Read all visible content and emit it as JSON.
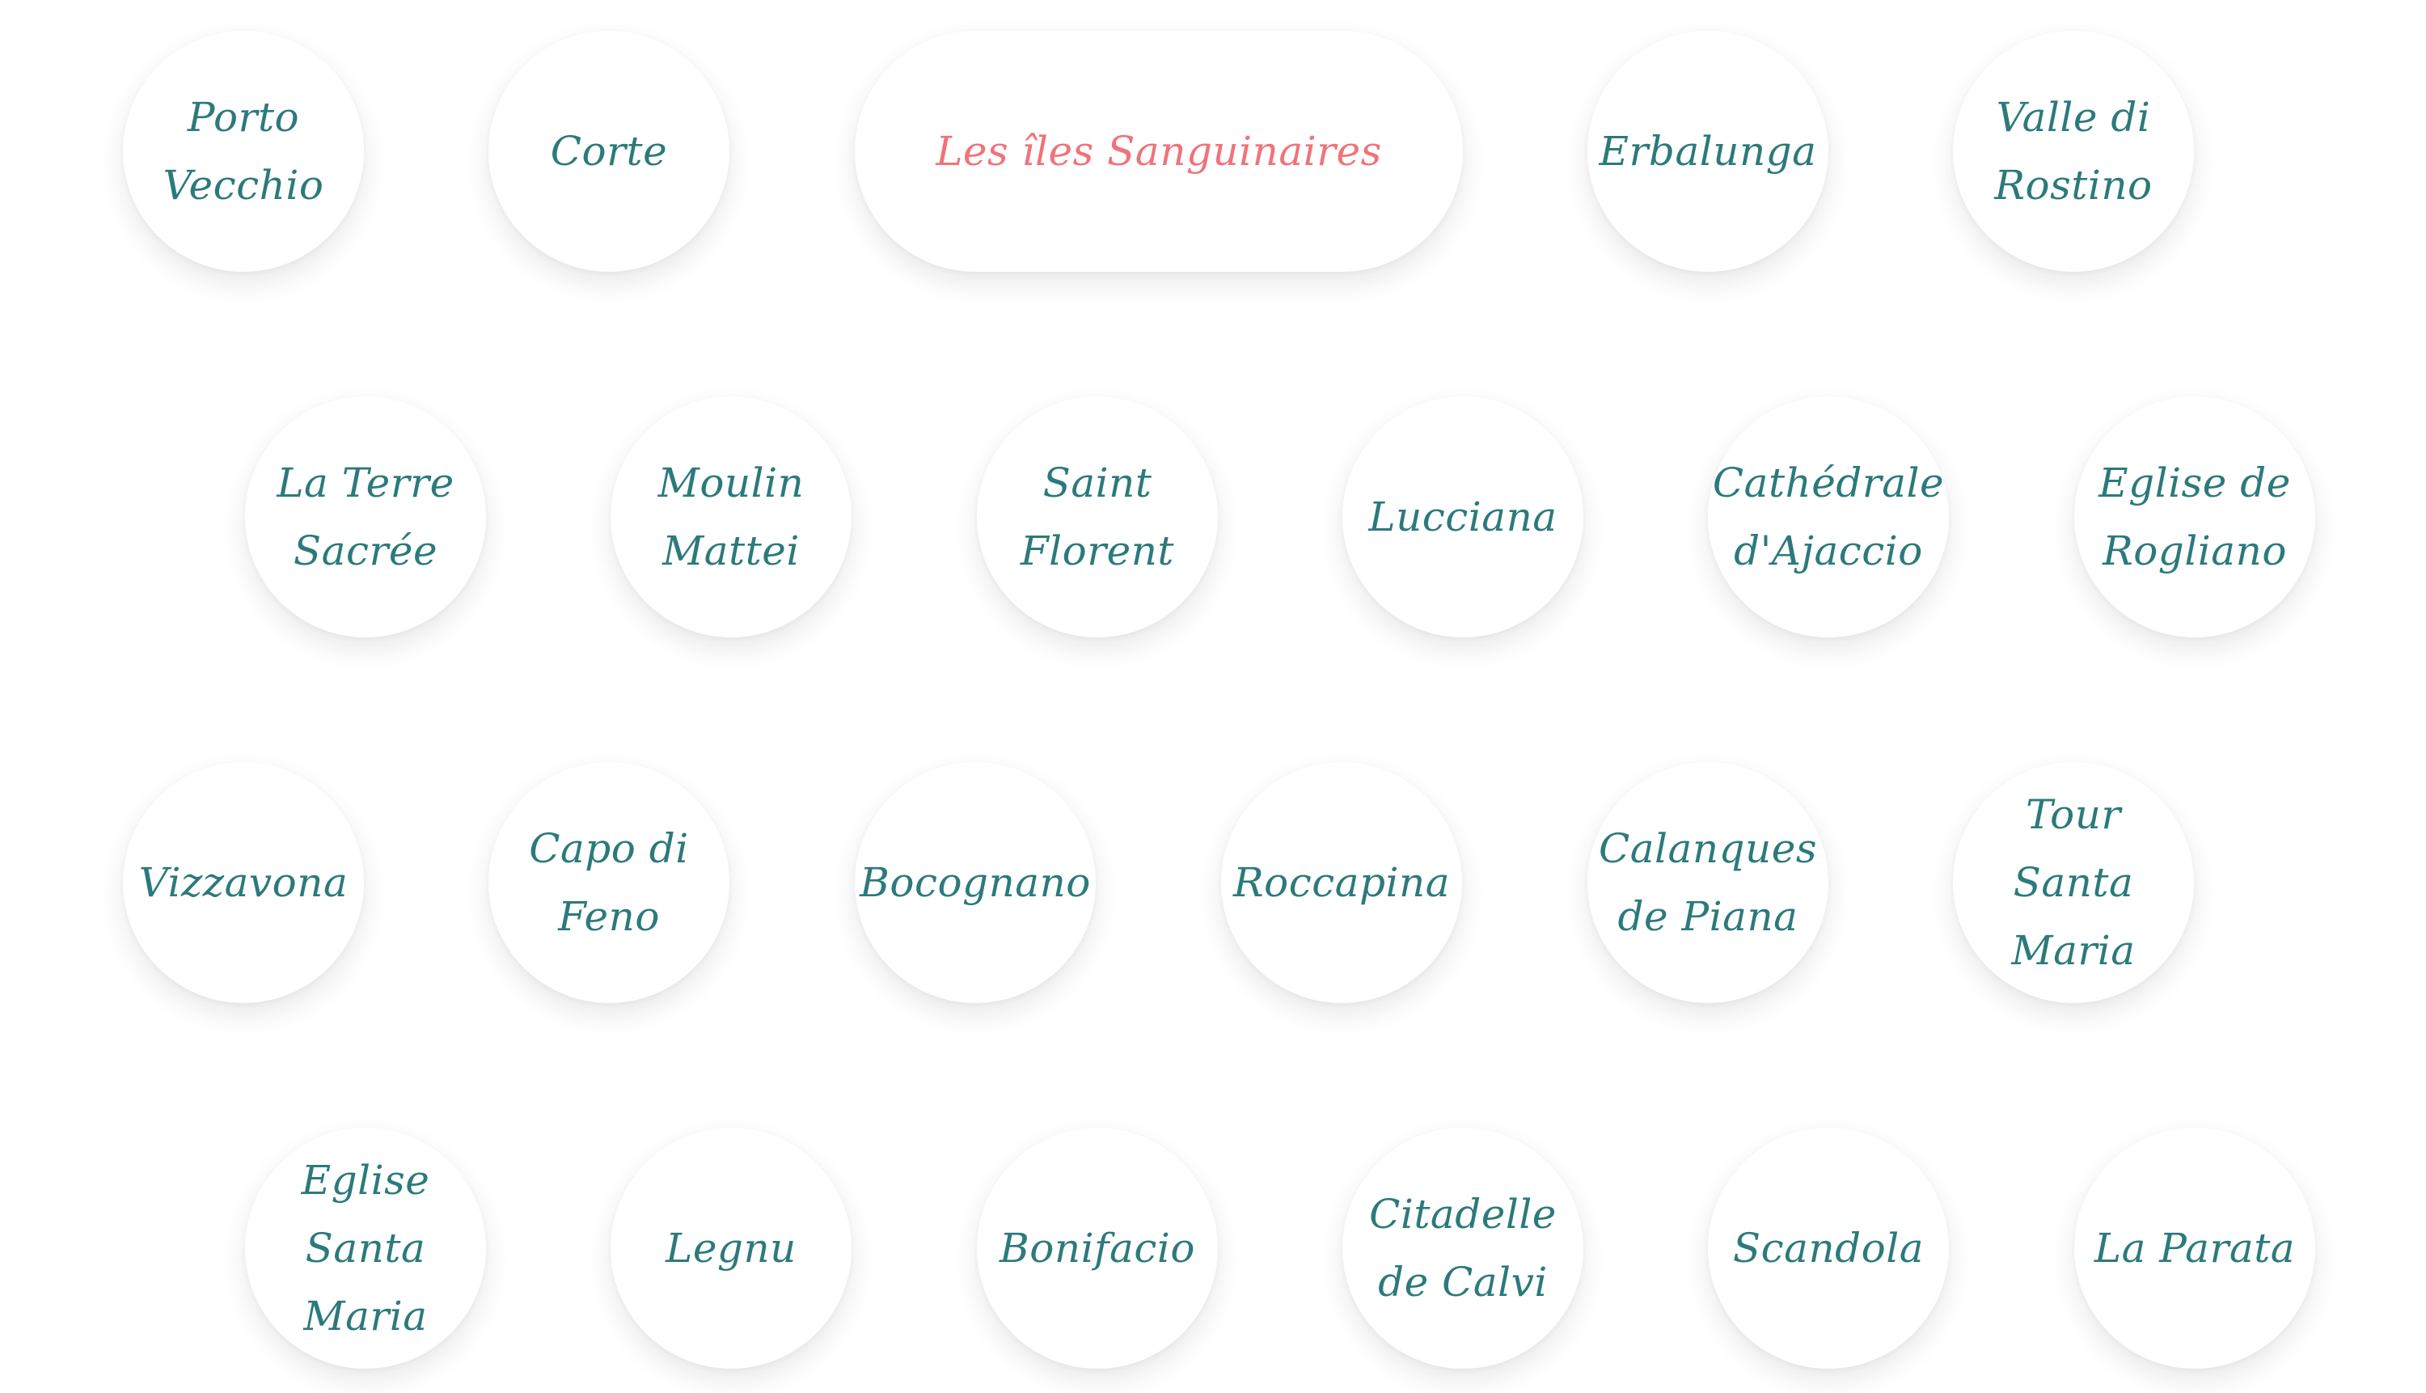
{
  "locations": {
    "active": "Les îles Sanguinaires",
    "colors": {
      "default_text": "#2c7a7b",
      "active_text": "#f0737a",
      "bubble_bg": "#ffffff"
    },
    "row1": [
      "Porto Vecchio",
      "Corte",
      "Les îles Sanguinaires",
      "Erbalunga",
      "Valle di Rostino"
    ],
    "row2": [
      "La Terre Sacrée",
      "Moulin Mattei",
      "Saint Florent",
      "Lucciana",
      "Cathédrale d'Ajaccio",
      "Eglise de Rogliano"
    ],
    "row3": [
      "Vizzavona",
      "Capo di Feno",
      "Bocognano",
      "Roccapina",
      "Calanques de Piana",
      "Tour Santa Maria"
    ],
    "row4": [
      "Eglise Santa Maria",
      "Legnu",
      "Bonifacio",
      "Citadelle de Calvi",
      "Scandola",
      "La Parata"
    ]
  }
}
